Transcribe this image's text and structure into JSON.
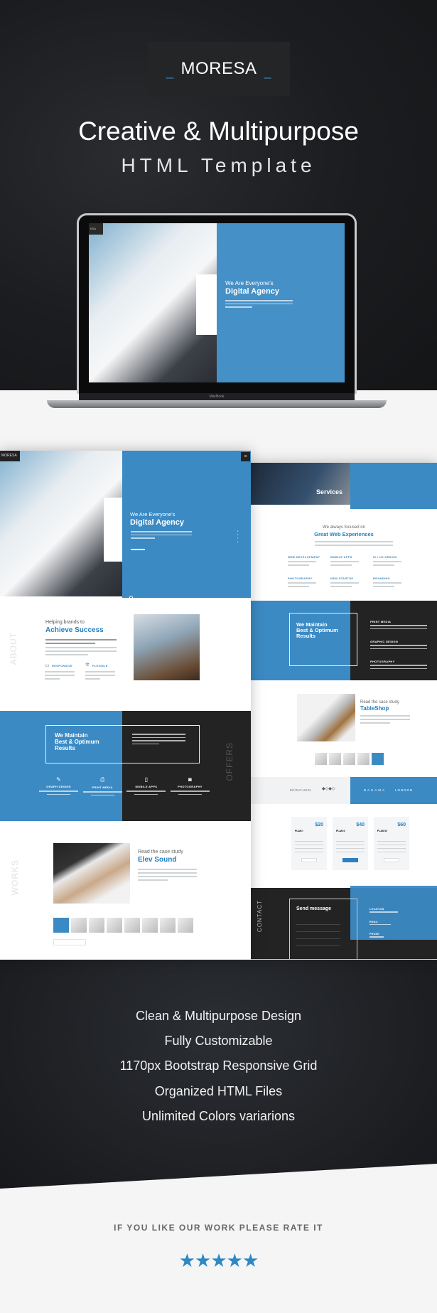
{
  "colors": {
    "accent": "#3b8ac4",
    "dark": "#232323",
    "background": "#f5f5f5"
  },
  "header": {
    "brand": "MORESA",
    "brand_dash": "_",
    "title": "Creative & Multipurpose",
    "subtitle": "HTML Template"
  },
  "laptop": {
    "brand_label": "MacBook",
    "logo": "ESA",
    "hero_small": "We Are Everyone's",
    "hero_big": "Digital Agency"
  },
  "left_mockup": {
    "logo": "MORESA",
    "hero": {
      "small": "We Are Everyone's",
      "big": "Digital Agency"
    },
    "about": {
      "section": "ABOUT",
      "small": "Helping brands to",
      "big": "Achieve Success",
      "features": [
        "Responsive",
        "Flexible"
      ]
    },
    "offers": {
      "section": "OFFERS",
      "heading_lines": [
        "We Maintain",
        "Best & Optimum",
        "Results"
      ],
      "services": [
        "Graph Design",
        "Print Media",
        "Mobile Apps",
        "Photography"
      ]
    },
    "works": {
      "section": "WORKS",
      "small": "Read the case study",
      "big": "Elev Sound"
    }
  },
  "right_mockup": {
    "services_title": "Services",
    "intro_small": "We always focused on",
    "intro_big": "Great Web Experiences",
    "services": [
      "Web Development",
      "Mobile Apps",
      "UI / UX Design",
      "Photography",
      "New Startup",
      "Branding"
    ],
    "maintain_lines": [
      "We Maintain",
      "Best & Optimum",
      "Results"
    ],
    "maintain_items": [
      "Print Media",
      "Graphic Design",
      "Photography"
    ],
    "case_small": "Read the case study",
    "case_big": "TableShop",
    "clients": [
      "MÜNCHEN",
      "BAHAMA",
      "LONDON"
    ],
    "plans": [
      {
        "name": "PLAN I",
        "price": "$20"
      },
      {
        "name": "PLAN II",
        "price": "$40"
      },
      {
        "name": "PLAN III",
        "price": "$60"
      }
    ],
    "contact_section": "CONTACT",
    "send_message": "Send message",
    "contact_labels": [
      "Location",
      "Email",
      "Phone"
    ]
  },
  "features": [
    "Clean & Multipurpose Design",
    "Fully Customizable",
    "1170px Bootstrap Responsive Grid",
    "Organized HTML Files",
    "Unlimited Colors variarions"
  ],
  "rating": {
    "prompt": "IF YOU LIKE OUR WORK PLEASE RATE IT",
    "stars": 5,
    "max": 5,
    "star_glyph": "★★★★★"
  }
}
